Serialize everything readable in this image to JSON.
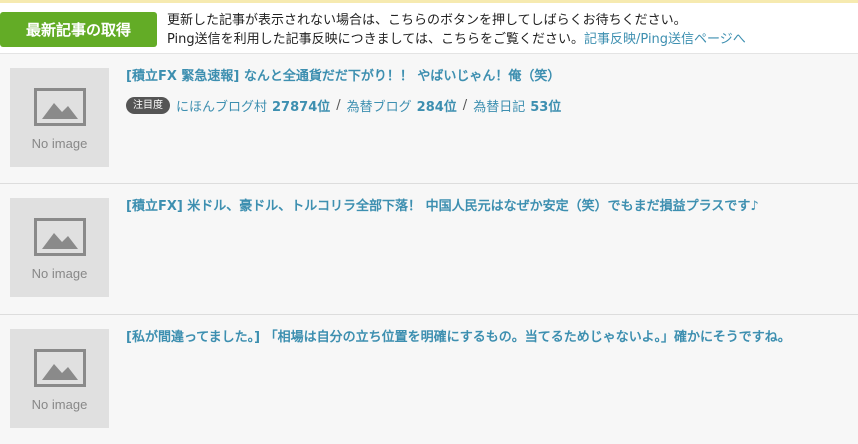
{
  "header": {
    "fetch_button_label": "最新記事の取得",
    "notice_line1": "更新した記事が表示されない場合は、こちらのボタンを押してしばらくお待ちください。",
    "notice_line2": "Ping送信を利用した記事反映につきましては、こちらをご覧ください。",
    "notice_link": "記事反映/Ping送信ページへ"
  },
  "thumbnail_label": "No image",
  "articles": [
    {
      "title": "[積立FX 緊急速報] なんと全通貨だだ下がり！！ やばいじゃん！俺（笑）",
      "badge": "注目度",
      "ranks": [
        {
          "site": "にほんブログ村",
          "rank": "27874位"
        },
        {
          "site": "為替ブログ",
          "rank": "284位"
        },
        {
          "site": "為替日記",
          "rank": "53位"
        }
      ]
    },
    {
      "title": "[積立FX] 米ドル、豪ドル、トルコリラ全部下落！ 中国人民元はなぜか安定（笑）でもまだ損益プラスです♪"
    },
    {
      "title": "[私が間違ってました。] 「相場は自分の立ち位置を明確にするもの。当てるためじゃないよ。」確かにそうですね。"
    }
  ],
  "rank_separator": "/",
  "colors": {
    "button": "#63ac26",
    "link": "#3d8fb0",
    "badge": "#555555",
    "row_background": "#f7f7f7",
    "thumbnail": "#e0e0e0"
  }
}
